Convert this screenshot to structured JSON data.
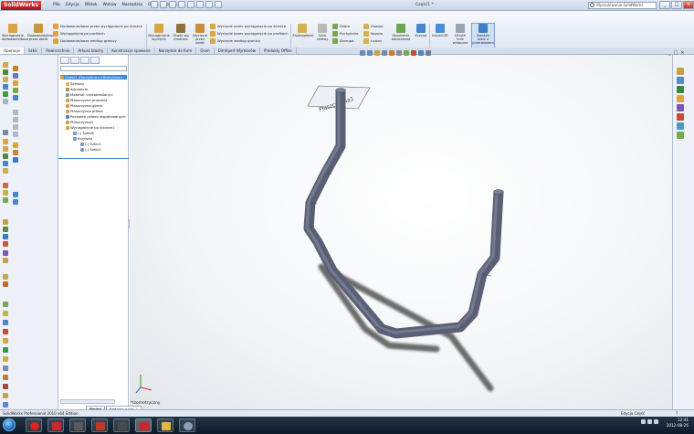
{
  "app": {
    "name": "SolidWorks",
    "document_title": "Część1 *",
    "status_product": "SolidWorks Professional 2010 x64 Edition",
    "status_mode": "Edycja Część",
    "status_extra": "?"
  },
  "menu": [
    "Plik",
    "Edycja",
    "Widok",
    "Wstaw",
    "Narzędzia",
    "Okno",
    "Pomoc"
  ],
  "search": {
    "placeholder": "Wyszukiwanie SolidWorks"
  },
  "window_controls": {
    "minimize": "_",
    "maximize": "□",
    "close": "✕"
  },
  "ribbon": {
    "big_buttons": [
      {
        "label": "Wyciągnięcie dodawanie/baza",
        "color": "#d9a441"
      },
      {
        "label": "Dodawanie/baza przez obrót",
        "color": "#c9963a"
      },
      {
        "label": "Wyciągnięcie wycięcia",
        "color": "#d9a441"
      },
      {
        "label": "Otwór wg kreatora",
        "color": "#8f6f3a"
      },
      {
        "label": "Wycięcie przez obrót",
        "color": "#c98f3a"
      },
      {
        "label": "Zaokrąglenie",
        "color": "#d8b04a"
      },
      {
        "label": "Szyk liniowy",
        "color": "#b8b8b8"
      },
      {
        "label": "Geometria odniesienia",
        "color": "#6aa84f"
      },
      {
        "label": "Krzywe",
        "color": "#4a86c8"
      },
      {
        "label": "Instant3D",
        "color": "#4a8ed8"
      },
      {
        "label": "Ukryte linie widoczne",
        "color": "#9aa4b0"
      },
      {
        "label": "Zamknij szkic z przerwaniem",
        "color": "#3e7fc8"
      }
    ],
    "rows_a": [
      "Dodawanie/baza przez wyciągnięcie po ścieżce",
      "Wyciągnięcie po profilach",
      "Dodawanie/baza według granicy"
    ],
    "rows_b": [
      "Wycięcie przez wyciągnięcie po ścieżce",
      "Wycięcie przez wyciągnięcie po profilach",
      "Wycięcie według granicy"
    ],
    "rows_c": [
      "Żebro",
      "Pochylenie",
      "Skorupa"
    ],
    "rows_d": [
      "Zawijaj",
      "Kopuła",
      "Lustro"
    ]
  },
  "tabs": [
    "Operacje",
    "Szkic",
    "Powierzchnie",
    "Arkusz blachy",
    "Konstrukcje spawane",
    "Narzędzia do form",
    "Oceń",
    "DimXpert Wymiarów",
    "Produkty Office"
  ],
  "feature_tree": {
    "root": "Część1 (Domyślna<<Domyślna>",
    "items": [
      {
        "label": "Sensory",
        "color": "#e0b64a"
      },
      {
        "label": "Adnotacje",
        "color": "#c08a3a"
      },
      {
        "label": "Materiał <nieokreślony>",
        "color": "#7a9ac8"
      },
      {
        "label": "Płaszczyzna przednia",
        "color": "#c9a24a"
      },
      {
        "label": "Płaszczyzna górna",
        "color": "#c9a24a"
      },
      {
        "label": "Płaszczyzna prawa",
        "color": "#c9a24a"
      },
      {
        "label": "Początek układu współrzędnych",
        "color": "#4a86c8"
      },
      {
        "label": "Płaszczyzna1",
        "color": "#c9a24a"
      },
      {
        "label": "Wyciągnięcie po ścieżce1",
        "color": "#d9a441"
      },
      {
        "label": "(-) Szkic8",
        "color": "#7f98c2"
      },
      {
        "label": "Krzywa4",
        "color": "#7f98c2"
      },
      {
        "label": "(-) Szkic1",
        "color": "#7f98c2"
      },
      {
        "label": "(-) Szkic2",
        "color": "#7f98c2"
      }
    ]
  },
  "viewport": {
    "plane_label": "Płaszczyzna1",
    "view_name": "*Izometryczny",
    "tube_color": "#5a6074",
    "shadow_color": "#4a4a4a"
  },
  "bottom_tabs": [
    "Model",
    "Badanie ruchu 1"
  ],
  "clock": {
    "time": "12:41",
    "date": "2012-08-26"
  },
  "colors": {
    "title_gradient_top": "#dfe7f2",
    "accent_blue": "#3f86d8",
    "taskbar": "#13263a"
  }
}
